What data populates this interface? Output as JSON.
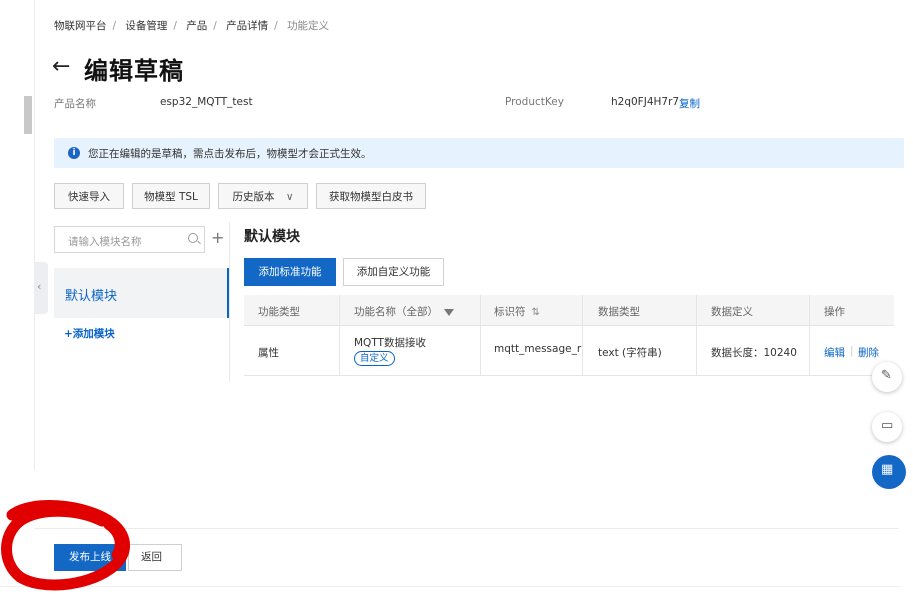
{
  "breadcrumb": [
    "物联网平台",
    "设备管理",
    "产品",
    "产品详情",
    "功能定义"
  ],
  "header": {
    "back_icon": "arrow-left-icon",
    "title": "编辑草稿"
  },
  "product": {
    "name_label": "产品名称",
    "name_value": "esp32_MQTT_test",
    "key_label": "ProductKey",
    "key_value": "h2q0FJ4H7r7",
    "copy_label": "复制"
  },
  "notice": {
    "icon": "info-icon",
    "text": "您正在编辑的是草稿，需点击发布后，物模型才会正式生效。"
  },
  "toolbar": {
    "quick_import": "快速导入",
    "tsl": "物模型 TSL",
    "history": "历史版本",
    "whitepaper": "获取物模型白皮书"
  },
  "sidebar": {
    "search_placeholder": "请输入模块名称",
    "selected_module": "默认模块",
    "add_module": "+添加模块"
  },
  "main": {
    "section_title": "默认模块",
    "add_standard": "添加标准功能",
    "add_custom": "添加自定义功能",
    "columns": [
      "功能类型",
      "功能名称（全部）",
      "标识符",
      "数据类型",
      "数据定义",
      "操作"
    ],
    "rows": [
      {
        "type": "属性",
        "name": "MQTT数据接收",
        "tag": "自定义",
        "identifier": "mqtt_message_r",
        "data_type": "text (字符串)",
        "definition": "数据长度：10240",
        "edit": "编辑",
        "delete": "删除"
      }
    ]
  },
  "footer": {
    "publish": "发布上线",
    "back": "返回"
  },
  "colors": {
    "primary": "#1368c6",
    "notice_bg": "#e6f2fd",
    "annotation": "#e00000"
  }
}
